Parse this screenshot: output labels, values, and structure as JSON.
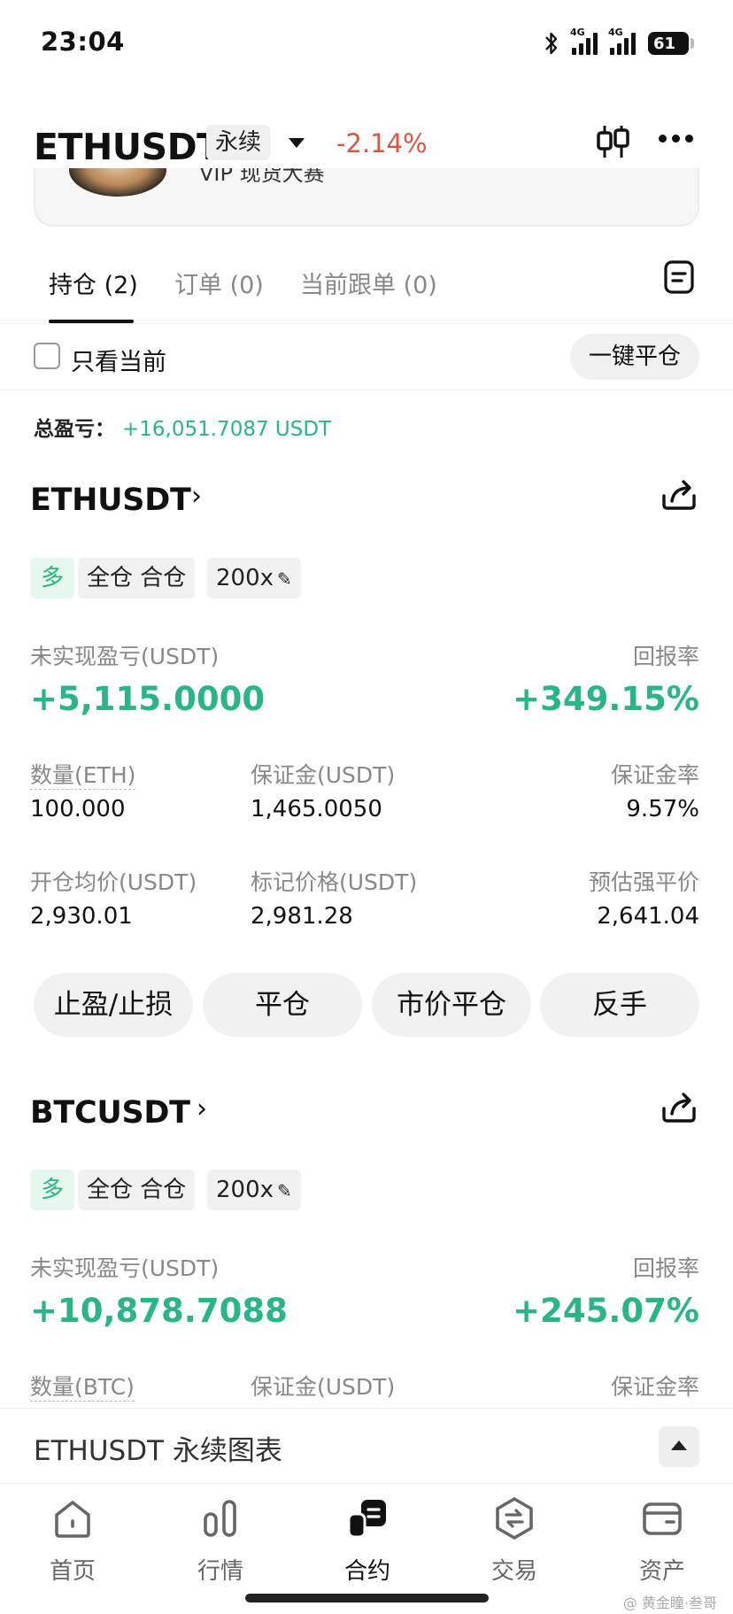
{
  "status_bar": {
    "time": "23:04",
    "battery": "61",
    "network_1": "4G",
    "network_2": "4G",
    "icons": [
      "bluetooth-icon",
      "signal-icon",
      "signal-icon",
      "battery-icon"
    ]
  },
  "header": {
    "symbol": "ETHUSDT",
    "contract_type": "永续",
    "change_percent": "-2.14%",
    "change_color": "#e0533f",
    "banner_text": "VIP 现货大赛"
  },
  "tabs": [
    {
      "label": "持仓 (2)",
      "active": true
    },
    {
      "label": "订单 (0)",
      "active": false
    },
    {
      "label": "当前跟单 (0)",
      "active": false
    }
  ],
  "filter": {
    "only_current_label": "只看当前",
    "only_current_checked": false,
    "close_all_label": "一键平仓"
  },
  "total_pnl": {
    "label": "总盈亏：",
    "value": "+16,051.7087 USDT"
  },
  "positions": [
    {
      "symbol": "ETHUSDT",
      "side": "多",
      "margin_mode": "全仓 合仓",
      "leverage": "200x",
      "unrealized_pnl_label": "未实现盈亏(USDT)",
      "unrealized_pnl": "+5,115.0000",
      "roe_label": "回报率",
      "roe": "+349.15%",
      "qty_label": "数量(ETH)",
      "qty": "100.000",
      "margin_label": "保证金(USDT)",
      "margin": "1,465.0050",
      "margin_ratio_label": "保证金率",
      "margin_ratio": "9.57%",
      "entry_label": "开仓均价(USDT)",
      "entry": "2,930.01",
      "mark_label": "标记价格(USDT)",
      "mark": "2,981.28",
      "liq_label": "预估强平价",
      "liq": "2,641.04",
      "actions": [
        "止盈/止损",
        "平仓",
        "市价平仓",
        "反手"
      ]
    },
    {
      "symbol": "BTCUSDT",
      "side": "多",
      "margin_mode": "全仓 合仓",
      "leverage": "200x",
      "unrealized_pnl_label": "未实现盈亏(USDT)",
      "unrealized_pnl": "+10,878.7088",
      "roe_label": "回报率",
      "roe": "+245.07%",
      "qty_label": "数量(BTC)",
      "margin_label": "保证金(USDT)",
      "margin_ratio_label": "保证金率"
    }
  ],
  "chart_bar": {
    "label": "ETHUSDT 永续图表"
  },
  "nav": [
    {
      "label": "首页",
      "icon": "home-icon",
      "active": false
    },
    {
      "label": "行情",
      "icon": "market-icon",
      "active": false
    },
    {
      "label": "合约",
      "icon": "futures-icon",
      "active": true
    },
    {
      "label": "交易",
      "icon": "trade-icon",
      "active": false
    },
    {
      "label": "资产",
      "icon": "wallet-icon",
      "active": false
    }
  ],
  "watermark": "@ 黄金瞳·叁哥",
  "colors": {
    "green": "#2ab585",
    "red": "#e0533f",
    "chip_bg": "#f1f1f1"
  }
}
